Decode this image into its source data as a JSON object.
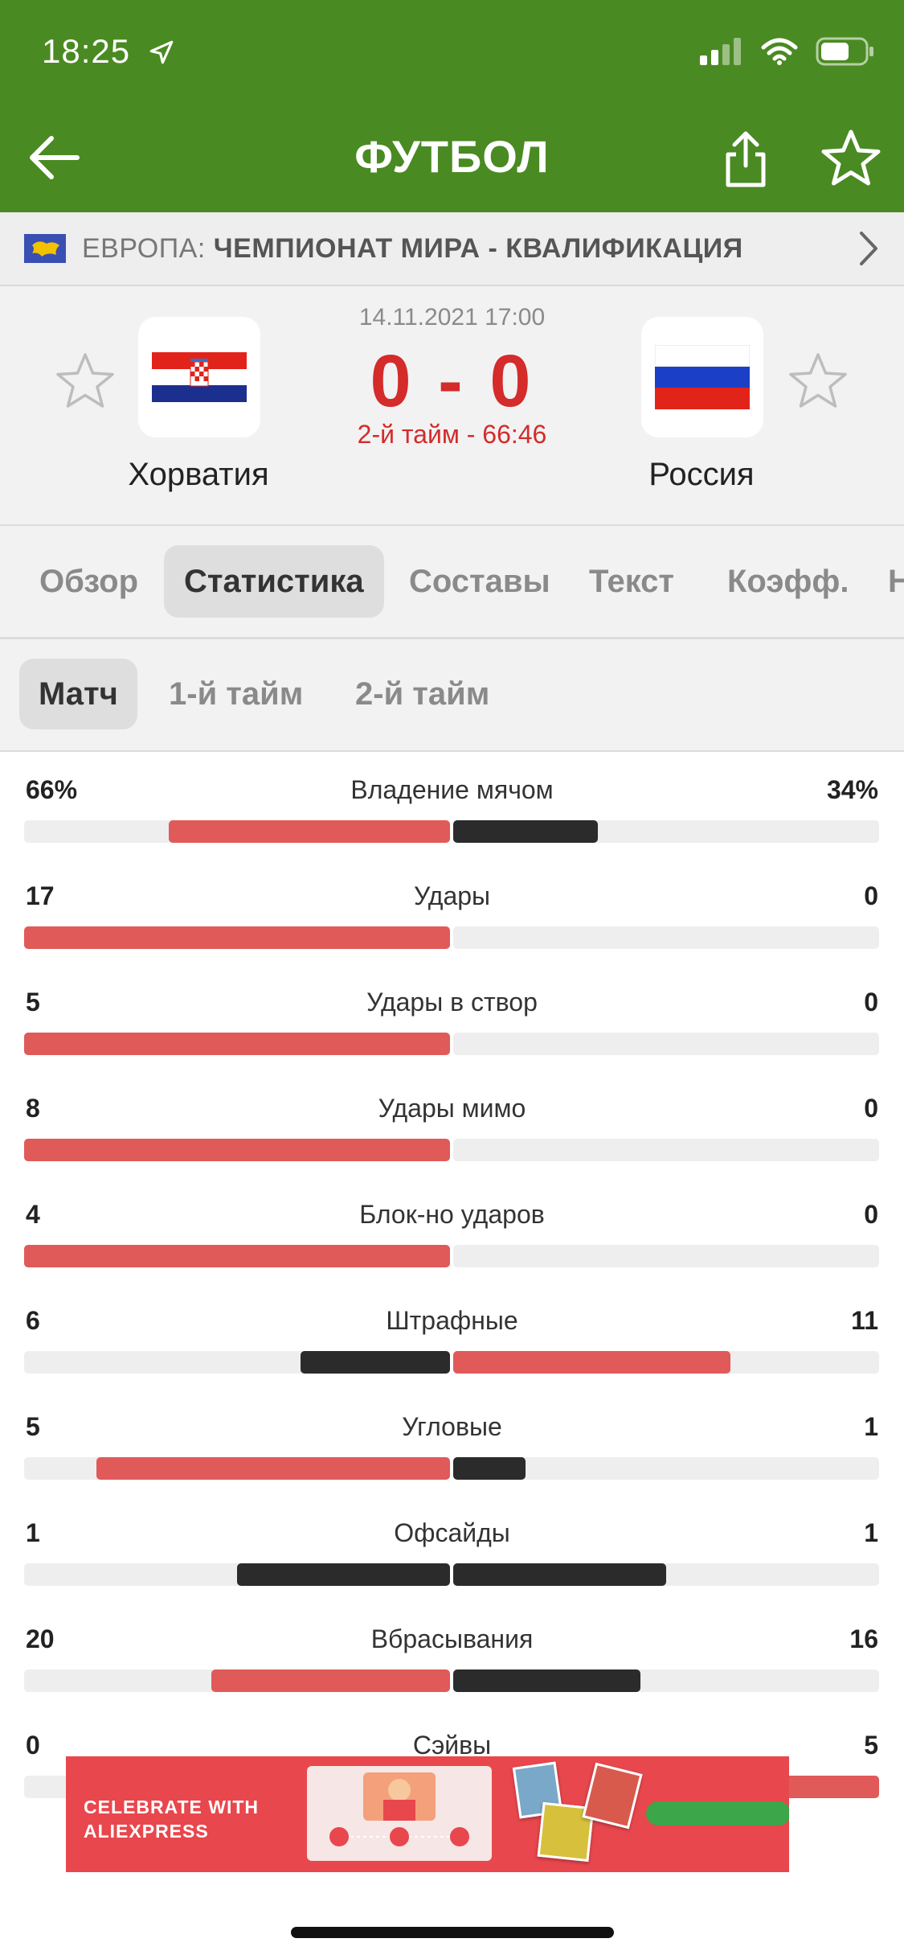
{
  "status": {
    "time": "18:25"
  },
  "header": {
    "title": "ФУТБОЛ"
  },
  "league": {
    "region": "ЕВРОПА:",
    "name": "ЧЕМПИОНАТ МИРА - КВАЛИФИКАЦИЯ"
  },
  "match": {
    "datetime": "14.11.2021 17:00",
    "score": "0 - 0",
    "period": "2-й тайм - 66:46",
    "home": {
      "name": "Хорватия"
    },
    "away": {
      "name": "Россия"
    }
  },
  "tabs": [
    "Обзор",
    "Статистика",
    "Составы",
    "Текст",
    "Коэфф.",
    "Н"
  ],
  "active_tab": "Статистика",
  "subtabs": [
    "Матч",
    "1-й тайм",
    "2-й тайм"
  ],
  "active_subtab": "Матч",
  "colors": {
    "header_green": "#4a8a22",
    "accent_red": "#e05a59",
    "dark_bar": "#2b2b2b",
    "score_red": "#d42b2b"
  },
  "stats": [
    {
      "name": "Владение мячом",
      "home": "66%",
      "away": "34%",
      "home_share": 0.66,
      "away_share": 0.34,
      "leader": "home"
    },
    {
      "name": "Удары",
      "home": "17",
      "away": "0",
      "home_share": 1.0,
      "away_share": 0.0,
      "leader": "home"
    },
    {
      "name": "Удары в створ",
      "home": "5",
      "away": "0",
      "home_share": 1.0,
      "away_share": 0.0,
      "leader": "home"
    },
    {
      "name": "Удары мимо",
      "home": "8",
      "away": "0",
      "home_share": 1.0,
      "away_share": 0.0,
      "leader": "home"
    },
    {
      "name": "Блок-но ударов",
      "home": "4",
      "away": "0",
      "home_share": 1.0,
      "away_share": 0.0,
      "leader": "home"
    },
    {
      "name": "Штрафные",
      "home": "6",
      "away": "11",
      "home_share": 0.35,
      "away_share": 0.65,
      "leader": "away"
    },
    {
      "name": "Угловые",
      "home": "5",
      "away": "1",
      "home_share": 0.83,
      "away_share": 0.17,
      "leader": "home"
    },
    {
      "name": "Офсайды",
      "home": "1",
      "away": "1",
      "home_share": 0.5,
      "away_share": 0.5,
      "leader": "none"
    },
    {
      "name": "Вбрасывания",
      "home": "20",
      "away": "16",
      "home_share": 0.56,
      "away_share": 0.44,
      "leader": "home"
    },
    {
      "name": "Сэйвы",
      "home": "0",
      "away": "5",
      "home_share": 0.0,
      "away_share": 1.0,
      "leader": "away"
    }
  ],
  "ad": {
    "text_line1": "CELEBRATE WITH",
    "text_line2": "ALIEXPRESS"
  }
}
